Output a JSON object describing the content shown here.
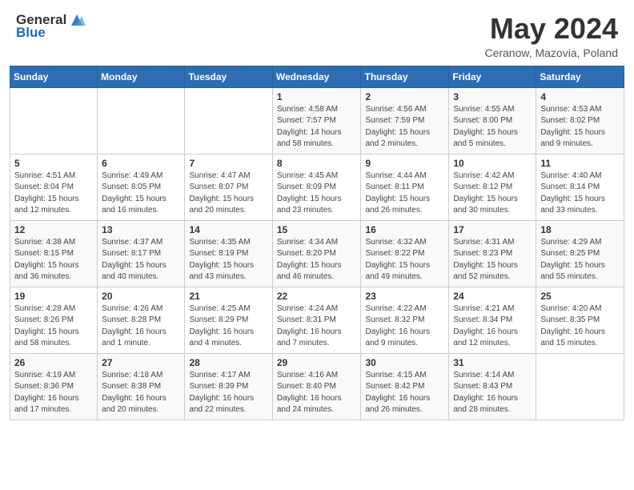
{
  "logo": {
    "general": "General",
    "blue": "Blue"
  },
  "title": "May 2024",
  "subtitle": "Ceranow, Mazovia, Poland",
  "days_of_week": [
    "Sunday",
    "Monday",
    "Tuesday",
    "Wednesday",
    "Thursday",
    "Friday",
    "Saturday"
  ],
  "weeks": [
    [
      {
        "num": "",
        "info": ""
      },
      {
        "num": "",
        "info": ""
      },
      {
        "num": "",
        "info": ""
      },
      {
        "num": "1",
        "info": "Sunrise: 4:58 AM\nSunset: 7:57 PM\nDaylight: 14 hours\nand 58 minutes."
      },
      {
        "num": "2",
        "info": "Sunrise: 4:56 AM\nSunset: 7:59 PM\nDaylight: 15 hours\nand 2 minutes."
      },
      {
        "num": "3",
        "info": "Sunrise: 4:55 AM\nSunset: 8:00 PM\nDaylight: 15 hours\nand 5 minutes."
      },
      {
        "num": "4",
        "info": "Sunrise: 4:53 AM\nSunset: 8:02 PM\nDaylight: 15 hours\nand 9 minutes."
      }
    ],
    [
      {
        "num": "5",
        "info": "Sunrise: 4:51 AM\nSunset: 8:04 PM\nDaylight: 15 hours\nand 12 minutes."
      },
      {
        "num": "6",
        "info": "Sunrise: 4:49 AM\nSunset: 8:05 PM\nDaylight: 15 hours\nand 16 minutes."
      },
      {
        "num": "7",
        "info": "Sunrise: 4:47 AM\nSunset: 8:07 PM\nDaylight: 15 hours\nand 20 minutes."
      },
      {
        "num": "8",
        "info": "Sunrise: 4:45 AM\nSunset: 8:09 PM\nDaylight: 15 hours\nand 23 minutes."
      },
      {
        "num": "9",
        "info": "Sunrise: 4:44 AM\nSunset: 8:11 PM\nDaylight: 15 hours\nand 26 minutes."
      },
      {
        "num": "10",
        "info": "Sunrise: 4:42 AM\nSunset: 8:12 PM\nDaylight: 15 hours\nand 30 minutes."
      },
      {
        "num": "11",
        "info": "Sunrise: 4:40 AM\nSunset: 8:14 PM\nDaylight: 15 hours\nand 33 minutes."
      }
    ],
    [
      {
        "num": "12",
        "info": "Sunrise: 4:38 AM\nSunset: 8:15 PM\nDaylight: 15 hours\nand 36 minutes."
      },
      {
        "num": "13",
        "info": "Sunrise: 4:37 AM\nSunset: 8:17 PM\nDaylight: 15 hours\nand 40 minutes."
      },
      {
        "num": "14",
        "info": "Sunrise: 4:35 AM\nSunset: 8:19 PM\nDaylight: 15 hours\nand 43 minutes."
      },
      {
        "num": "15",
        "info": "Sunrise: 4:34 AM\nSunset: 8:20 PM\nDaylight: 15 hours\nand 46 minutes."
      },
      {
        "num": "16",
        "info": "Sunrise: 4:32 AM\nSunset: 8:22 PM\nDaylight: 15 hours\nand 49 minutes."
      },
      {
        "num": "17",
        "info": "Sunrise: 4:31 AM\nSunset: 8:23 PM\nDaylight: 15 hours\nand 52 minutes."
      },
      {
        "num": "18",
        "info": "Sunrise: 4:29 AM\nSunset: 8:25 PM\nDaylight: 15 hours\nand 55 minutes."
      }
    ],
    [
      {
        "num": "19",
        "info": "Sunrise: 4:28 AM\nSunset: 8:26 PM\nDaylight: 15 hours\nand 58 minutes."
      },
      {
        "num": "20",
        "info": "Sunrise: 4:26 AM\nSunset: 8:28 PM\nDaylight: 16 hours\nand 1 minute."
      },
      {
        "num": "21",
        "info": "Sunrise: 4:25 AM\nSunset: 8:29 PM\nDaylight: 16 hours\nand 4 minutes."
      },
      {
        "num": "22",
        "info": "Sunrise: 4:24 AM\nSunset: 8:31 PM\nDaylight: 16 hours\nand 7 minutes."
      },
      {
        "num": "23",
        "info": "Sunrise: 4:22 AM\nSunset: 8:32 PM\nDaylight: 16 hours\nand 9 minutes."
      },
      {
        "num": "24",
        "info": "Sunrise: 4:21 AM\nSunset: 8:34 PM\nDaylight: 16 hours\nand 12 minutes."
      },
      {
        "num": "25",
        "info": "Sunrise: 4:20 AM\nSunset: 8:35 PM\nDaylight: 16 hours\nand 15 minutes."
      }
    ],
    [
      {
        "num": "26",
        "info": "Sunrise: 4:19 AM\nSunset: 8:36 PM\nDaylight: 16 hours\nand 17 minutes."
      },
      {
        "num": "27",
        "info": "Sunrise: 4:18 AM\nSunset: 8:38 PM\nDaylight: 16 hours\nand 20 minutes."
      },
      {
        "num": "28",
        "info": "Sunrise: 4:17 AM\nSunset: 8:39 PM\nDaylight: 16 hours\nand 22 minutes."
      },
      {
        "num": "29",
        "info": "Sunrise: 4:16 AM\nSunset: 8:40 PM\nDaylight: 16 hours\nand 24 minutes."
      },
      {
        "num": "30",
        "info": "Sunrise: 4:15 AM\nSunset: 8:42 PM\nDaylight: 16 hours\nand 26 minutes."
      },
      {
        "num": "31",
        "info": "Sunrise: 4:14 AM\nSunset: 8:43 PM\nDaylight: 16 hours\nand 28 minutes."
      },
      {
        "num": "",
        "info": ""
      }
    ]
  ]
}
